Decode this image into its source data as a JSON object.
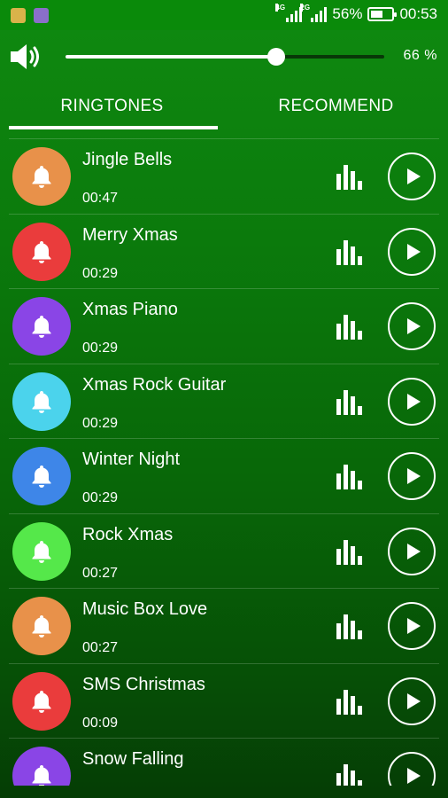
{
  "status_bar": {
    "battery_text": "56%",
    "time": "00:53",
    "network_1": "4G",
    "network_2": "2G",
    "battery_level": 0.56,
    "app_icons": [
      {
        "name": "notification-app-icon",
        "color": "#d9b34a"
      },
      {
        "name": "notification-gallery-icon",
        "color": "#8a6fc9"
      }
    ]
  },
  "volume": {
    "icon": "speaker-icon",
    "level_fraction": 0.66,
    "value_text": "66 %"
  },
  "tabs": [
    {
      "label": "RINGTONES",
      "selected": true
    },
    {
      "label": "RECOMMEND",
      "selected": false
    }
  ],
  "ringtones": [
    {
      "title": "Jingle Bells",
      "duration": "00:47",
      "color": "#e8914a"
    },
    {
      "title": "Merry Xmas",
      "duration": "00:29",
      "color": "#ea3c3c"
    },
    {
      "title": "Xmas Piano",
      "duration": "00:29",
      "color": "#8a45e6"
    },
    {
      "title": "Xmas Rock Guitar",
      "duration": "00:29",
      "color": "#4bd3ec"
    },
    {
      "title": "Winter Night",
      "duration": "00:29",
      "color": "#3e86e8"
    },
    {
      "title": "Rock Xmas",
      "duration": "00:27",
      "color": "#55e84a"
    },
    {
      "title": "Music Box Love",
      "duration": "00:27",
      "color": "#e8914a"
    },
    {
      "title": "SMS Christmas",
      "duration": "00:09",
      "color": "#ea3c3c"
    },
    {
      "title": "Snow Falling",
      "duration": "",
      "color": "#8a45e6"
    }
  ],
  "row_icons": {
    "leading": "bell-icon",
    "level": "equalizer-icon",
    "action": "play-icon"
  }
}
